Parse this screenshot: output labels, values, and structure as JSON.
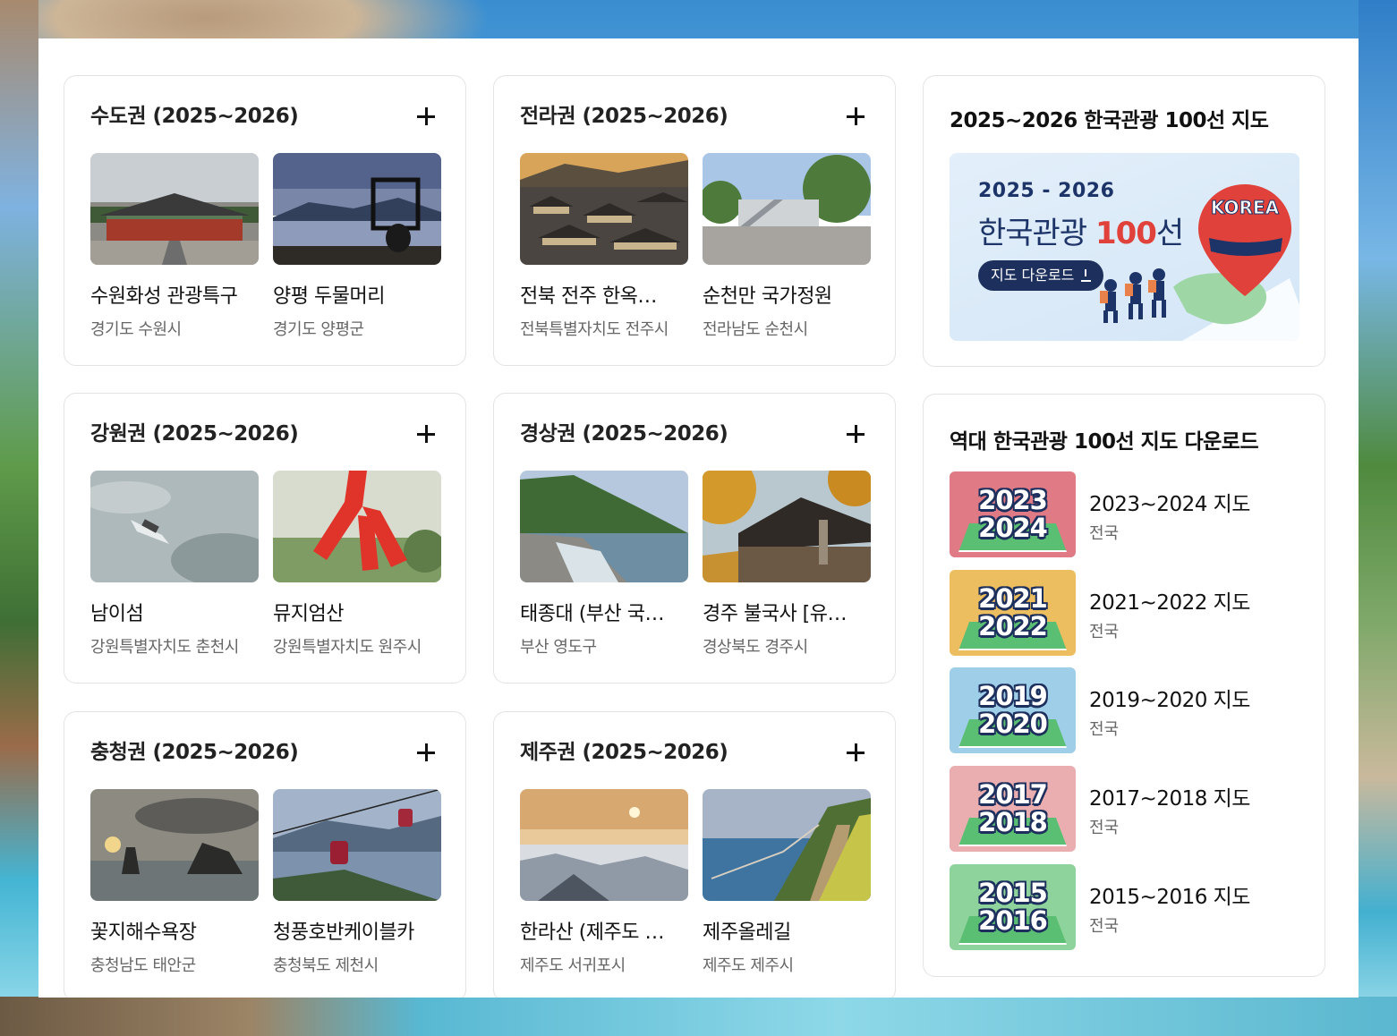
{
  "regions": [
    {
      "title": "수도권 (2025~2026)",
      "spots": [
        {
          "name": "수원화성 관광특구",
          "location": "경기도 수원시"
        },
        {
          "name": "양평 두물머리",
          "location": "경기도 양평군"
        }
      ]
    },
    {
      "title": "전라권 (2025~2026)",
      "spots": [
        {
          "name": "전북 전주 한옥…",
          "location": "전북특별자치도 전주시"
        },
        {
          "name": "순천만 국가정원",
          "location": "전라남도 순천시"
        }
      ]
    },
    {
      "title": "강원권 (2025~2026)",
      "spots": [
        {
          "name": "남이섬",
          "location": "강원특별자치도 춘천시"
        },
        {
          "name": "뮤지엄산",
          "location": "강원특별자치도 원주시"
        }
      ]
    },
    {
      "title": "경상권 (2025~2026)",
      "spots": [
        {
          "name": "태종대 (부산 국…",
          "location": "부산 영도구"
        },
        {
          "name": "경주 불국사 [유…",
          "location": "경상북도 경주시"
        }
      ]
    },
    {
      "title": "충청권 (2025~2026)",
      "spots": [
        {
          "name": "꽃지해수욕장",
          "location": "충청남도 태안군"
        },
        {
          "name": "청풍호반케이블카",
          "location": "충청북도 제천시"
        }
      ]
    },
    {
      "title": "제주권 (2025~2026)",
      "spots": [
        {
          "name": "한라산 (제주도 …",
          "location": "제주도 서귀포시"
        },
        {
          "name": "제주올레길",
          "location": "제주도 제주시"
        }
      ]
    }
  ],
  "map_card": {
    "title": "2025~2026 한국관광 100선 지도",
    "banner_years": "2025 - 2026",
    "banner_title_prefix": "한국관광 ",
    "banner_title_highlight": "100",
    "banner_title_suffix": "선",
    "banner_button": "지도 다운로드",
    "banner_badge": "KOREA"
  },
  "past_maps": {
    "title": "역대 한국관광 100선 지도 다운로드",
    "items": [
      {
        "year_top": "2023",
        "year_bottom": "2024",
        "label": "2023~2024 지도",
        "sub": "전국",
        "color": "#e07b86"
      },
      {
        "year_top": "2021",
        "year_bottom": "2022",
        "label": "2021~2022 지도",
        "sub": "전국",
        "color": "#ecbe5f"
      },
      {
        "year_top": "2019",
        "year_bottom": "2020",
        "label": "2019~2020 지도",
        "sub": "전국",
        "color": "#9fcfe8"
      },
      {
        "year_top": "2017",
        "year_bottom": "2018",
        "label": "2017~2018 지도",
        "sub": "전국",
        "color": "#eaaeb0"
      },
      {
        "year_top": "2015",
        "year_bottom": "2016",
        "label": "2015~2016 지도",
        "sub": "전국",
        "color": "#8fd39c"
      }
    ]
  }
}
